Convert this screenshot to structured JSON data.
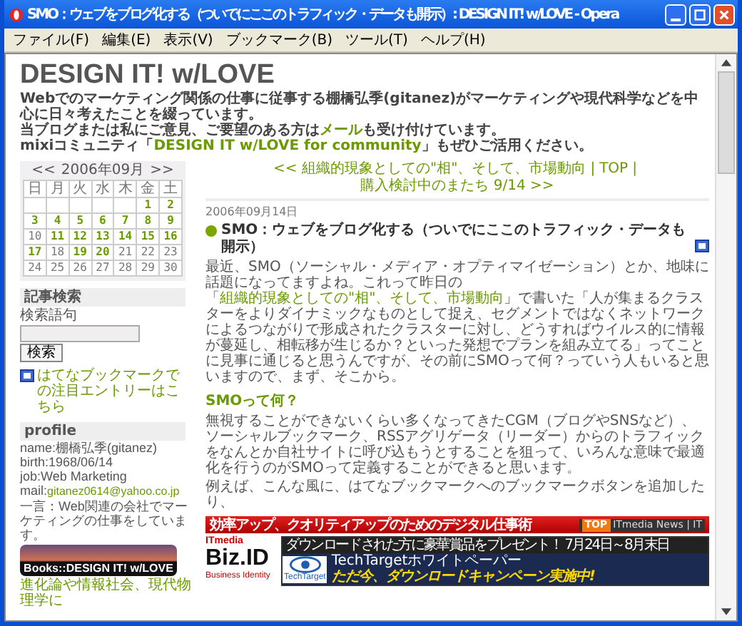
{
  "window": {
    "title": "SMO：ウェブをブログ化する（ついでにここのトラフィック・データも開示）: DESIGN IT! w/LOVE - Opera"
  },
  "menu": [
    "ファイル(F)",
    "編集(E)",
    "表示(V)",
    "ブックマーク(B)",
    "ツール(T)",
    "ヘルプ(H)"
  ],
  "blog": {
    "title": "DESIGN IT! w/LOVE",
    "description": [
      {
        "before": "Webでのマーケティング関係の仕事に従事する棚橋弘季(gitanez)がマーケティングや現代科学などを中心に日々考えたことを綴っています。"
      },
      {
        "before": "当ブログまたは私にご意見、ご要望のある方は",
        "link": "メール",
        "after": "も受け付けています。"
      },
      {
        "before": "mixiコミュニティ「",
        "link": "DESIGN IT w/LOVE for community",
        "after": "」もぜひご活用ください。"
      }
    ]
  },
  "calendar": {
    "prev": "<<",
    "month": "2006年09月",
    "next": ">>",
    "weekdays": [
      "日",
      "月",
      "火",
      "水",
      "木",
      "金",
      "土"
    ],
    "weeks": [
      [
        {
          "kind": "blank"
        },
        {
          "kind": "blank"
        },
        {
          "kind": "blank"
        },
        {
          "kind": "blank"
        },
        {
          "kind": "blank"
        },
        {
          "kind": "day",
          "day": "1",
          "linked": true
        },
        {
          "kind": "day",
          "day": "2",
          "linked": true
        }
      ],
      [
        {
          "kind": "day",
          "day": "3",
          "linked": true
        },
        {
          "kind": "day",
          "day": "4",
          "linked": true
        },
        {
          "kind": "day",
          "day": "5",
          "linked": true
        },
        {
          "kind": "day",
          "day": "6",
          "linked": true
        },
        {
          "kind": "day",
          "day": "7",
          "linked": true
        },
        {
          "kind": "day",
          "day": "8",
          "linked": true
        },
        {
          "kind": "day",
          "day": "9",
          "linked": true
        }
      ],
      [
        {
          "kind": "day",
          "day": "10",
          "linked": false
        },
        {
          "kind": "day",
          "day": "11",
          "linked": true
        },
        {
          "kind": "day",
          "day": "12",
          "linked": true
        },
        {
          "kind": "day",
          "day": "13",
          "linked": true
        },
        {
          "kind": "day",
          "day": "14",
          "linked": true
        },
        {
          "kind": "day",
          "day": "15",
          "linked": true
        },
        {
          "kind": "day",
          "day": "16",
          "linked": true
        }
      ],
      [
        {
          "kind": "day",
          "day": "17",
          "linked": true
        },
        {
          "kind": "day",
          "day": "18",
          "linked": false
        },
        {
          "kind": "day",
          "day": "19",
          "linked": true
        },
        {
          "kind": "day",
          "day": "20",
          "linked": true
        },
        {
          "kind": "day",
          "day": "21",
          "linked": false
        },
        {
          "kind": "day",
          "day": "22",
          "linked": false
        },
        {
          "kind": "day",
          "day": "23",
          "linked": false
        }
      ],
      [
        {
          "kind": "day",
          "day": "24",
          "linked": false
        },
        {
          "kind": "day",
          "day": "25",
          "linked": false
        },
        {
          "kind": "day",
          "day": "26",
          "linked": false
        },
        {
          "kind": "day",
          "day": "27",
          "linked": false
        },
        {
          "kind": "day",
          "day": "28",
          "linked": false
        },
        {
          "kind": "day",
          "day": "29",
          "linked": false
        },
        {
          "kind": "day",
          "day": "30",
          "linked": false
        }
      ]
    ]
  },
  "search": {
    "title": "記事検索",
    "label": "検索語句",
    "button": "検索"
  },
  "hatena_link": "はてなブックマークでの注目エントリーはこちら",
  "profile": {
    "title": "profile",
    "lines": [
      {
        "before": "name:棚橋弘季(gitanez)"
      },
      {
        "before": "birth:1968/06/14"
      },
      {
        "before": "job:Web Marketing"
      },
      {
        "before": "mail:",
        "link": "gitanez0614@yahoo.co.jp"
      },
      {
        "before": "一言：Web関連の会社でマーケティングの仕事をしています。"
      }
    ]
  },
  "books_banner": "Books::DESIGN IT! w/LOVE",
  "books_caption": "進化論や情報社会、現代物理学に",
  "entry_nav": [
    {
      "kind": "link",
      "text": "<< 組織的現象としての\"相\"、そして、市場動向"
    },
    {
      "kind": "separator",
      "text": "|"
    },
    {
      "kind": "link",
      "text": "TOP"
    },
    {
      "kind": "separator",
      "text": "|"
    },
    {
      "kind": "link",
      "text": "購入検討中のまたち 9/14 >>"
    }
  ],
  "entry": {
    "date": "2006年09月14日",
    "title": "SMO：ウェブをブログ化する（ついでにここのトラフィック・データも開示）",
    "blocks": [
      {
        "kind": "paragraph",
        "before": "最近、SMO（ソーシャル・メディア・オプティマイゼーション）とか、地味に話題になってますよね。これって昨日の「",
        "link": "組織的現象としての\"相\"、そして、市場動向",
        "after": "」で書いた「人が集まるクラスターをよりダイナミックなものとして捉え、セグメントではなくネットワークによるつながりで形成されたクラスターに対し、どうすればウイルス的に情報が蔓延し、相転移が生じるか？といった発想でプランを組み立てる」ってことに見事に通じると思うんですが、その前にSMOって何？っていう人もいると思いますので、まず、そこから。"
      },
      {
        "kind": "subheading",
        "text": "SMOって何？"
      },
      {
        "kind": "paragraph",
        "before": "無視することができないくらい多くなってきたCGM（ブログやSNSなど）、ソーシャルブックマーク、RSSアグリゲータ（リーダー）からのトラフィックをなんとか自社サイトに呼び込もうとすることを狙って、いろんな意味で最適化を行うのがSMOって定義することができると思います。"
      },
      {
        "kind": "paragraph",
        "before": "例えば、こんな風に、はてなブックマークへのブックマークボタンを追加したり、"
      }
    ]
  },
  "ad": {
    "header": "効率アップ、クオリティアップのためのデジタル仕事術",
    "badge": "TOP",
    "header_link": "ITmedia News | IT",
    "logo_small": "ITmedia",
    "logo": "Biz.ID",
    "logo_sub": "Business Identity",
    "banner_top": "ダウンロードされた方に豪華賞品をプレゼント！ 7月24日～8月末日",
    "banner_brand": "TechTarget",
    "banner_line1": "TechTargetホワイトペーパー",
    "banner_line2": "ただ今、ダウンロードキャンペーン実施中!"
  }
}
